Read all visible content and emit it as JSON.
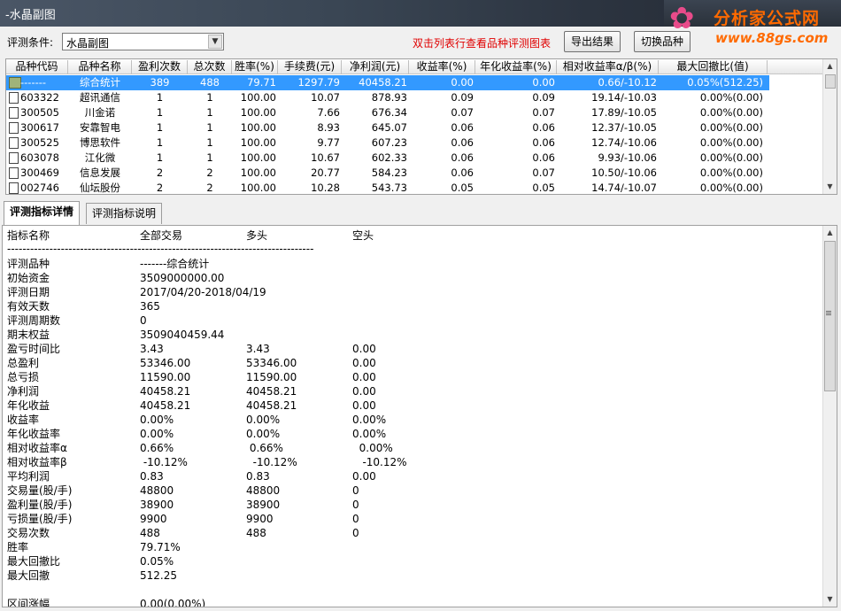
{
  "window": {
    "title": "-水晶副图"
  },
  "logo": {
    "brand": "分析家公式网",
    "url": "www.88gs.com"
  },
  "toolbar": {
    "condition_label": "评测条件:",
    "condition_value": "水晶副图",
    "hint": "双击列表行查看品种评测图表",
    "export_label": "导出结果",
    "switch_label": "切换品种"
  },
  "table": {
    "columns": [
      "品种代码",
      "品种名称",
      "盈利次数",
      "总次数",
      "胜率(%)",
      "手续费(元)",
      "净利润(元)",
      "收益率(%)",
      "年化收益率(%)",
      "相对收益率α/β(%)",
      "最大回撤比(值)"
    ],
    "rows": [
      [
        "-------",
        "综合统计",
        "389",
        "488",
        "79.71",
        "1297.79",
        "40458.21",
        "0.00",
        "0.00",
        "0.66/-10.12",
        "0.05%(512.25)"
      ],
      [
        "603322",
        "超讯通信",
        "1",
        "1",
        "100.00",
        "10.07",
        "878.93",
        "0.09",
        "0.09",
        "19.14/-10.03",
        "0.00%(0.00)"
      ],
      [
        "300505",
        "川金诺",
        "1",
        "1",
        "100.00",
        "7.66",
        "676.34",
        "0.07",
        "0.07",
        "17.89/-10.05",
        "0.00%(0.00)"
      ],
      [
        "300617",
        "安靠智电",
        "1",
        "1",
        "100.00",
        "8.93",
        "645.07",
        "0.06",
        "0.06",
        "12.37/-10.05",
        "0.00%(0.00)"
      ],
      [
        "300525",
        "博思软件",
        "1",
        "1",
        "100.00",
        "9.77",
        "607.23",
        "0.06",
        "0.06",
        "12.74/-10.06",
        "0.00%(0.00)"
      ],
      [
        "603078",
        "江化微",
        "1",
        "1",
        "100.00",
        "10.67",
        "602.33",
        "0.06",
        "0.06",
        "9.93/-10.06",
        "0.00%(0.00)"
      ],
      [
        "300469",
        "信息发展",
        "2",
        "2",
        "100.00",
        "20.77",
        "584.23",
        "0.06",
        "0.07",
        "10.50/-10.06",
        "0.00%(0.00)"
      ],
      [
        "002746",
        "仙坛股份",
        "2",
        "2",
        "100.00",
        "10.28",
        "543.73",
        "0.05",
        "0.05",
        "14.74/-10.07",
        "0.00%(0.00)"
      ]
    ]
  },
  "tabs": [
    "评测指标详情",
    "评测指标说明"
  ],
  "detail": {
    "header": [
      "指标名称",
      "全部交易",
      "多头",
      "空头"
    ],
    "separator": "--------------------------------------------------------------------------------",
    "lines": [
      [
        "评测品种",
        "-------综合统计",
        "",
        ""
      ],
      [
        "初始资金",
        "3509000000.00",
        "",
        ""
      ],
      [
        "评测日期",
        "2017/04/20-2018/04/19",
        "",
        ""
      ],
      [
        "有效天数",
        "365",
        "",
        ""
      ],
      [
        "评测周期数",
        "0",
        "",
        ""
      ],
      [
        "期末权益",
        "3509040459.44",
        "",
        ""
      ],
      [
        "盈亏时间比",
        "3.43",
        "3.43",
        "0.00"
      ],
      [
        "总盈利",
        "53346.00",
        "53346.00",
        "0.00"
      ],
      [
        "总亏损",
        "11590.00",
        "11590.00",
        "0.00"
      ],
      [
        "净利润",
        "40458.21",
        "40458.21",
        "0.00"
      ],
      [
        "年化收益",
        "40458.21",
        "40458.21",
        "0.00"
      ],
      [
        "收益率",
        "0.00%",
        "0.00%",
        "0.00%"
      ],
      [
        "年化收益率",
        "0.00%",
        "0.00%",
        "0.00%"
      ],
      [
        "相对收益率α",
        "0.66%",
        " 0.66%",
        "  0.00%"
      ],
      [
        "相对收益率β",
        " -10.12%",
        "  -10.12%",
        "   -10.12%"
      ],
      [
        "平均利润",
        "0.83",
        "0.83",
        "0.00"
      ],
      [
        "交易量(股/手)",
        "48800",
        "48800",
        "0"
      ],
      [
        "盈利量(股/手)",
        "38900",
        "38900",
        "0"
      ],
      [
        "亏损量(股/手)",
        "9900",
        "9900",
        "0"
      ],
      [
        "交易次数",
        "488",
        "488",
        "0"
      ],
      [
        "胜率",
        "79.71%",
        "",
        ""
      ],
      [
        "最大回撤比",
        "0.05%",
        "",
        ""
      ],
      [
        "最大回撤",
        "512.25",
        "",
        ""
      ],
      [
        "",
        "",
        "",
        ""
      ],
      [
        "区间涨幅",
        "0.00(0.00%)",
        "",
        ""
      ]
    ]
  }
}
